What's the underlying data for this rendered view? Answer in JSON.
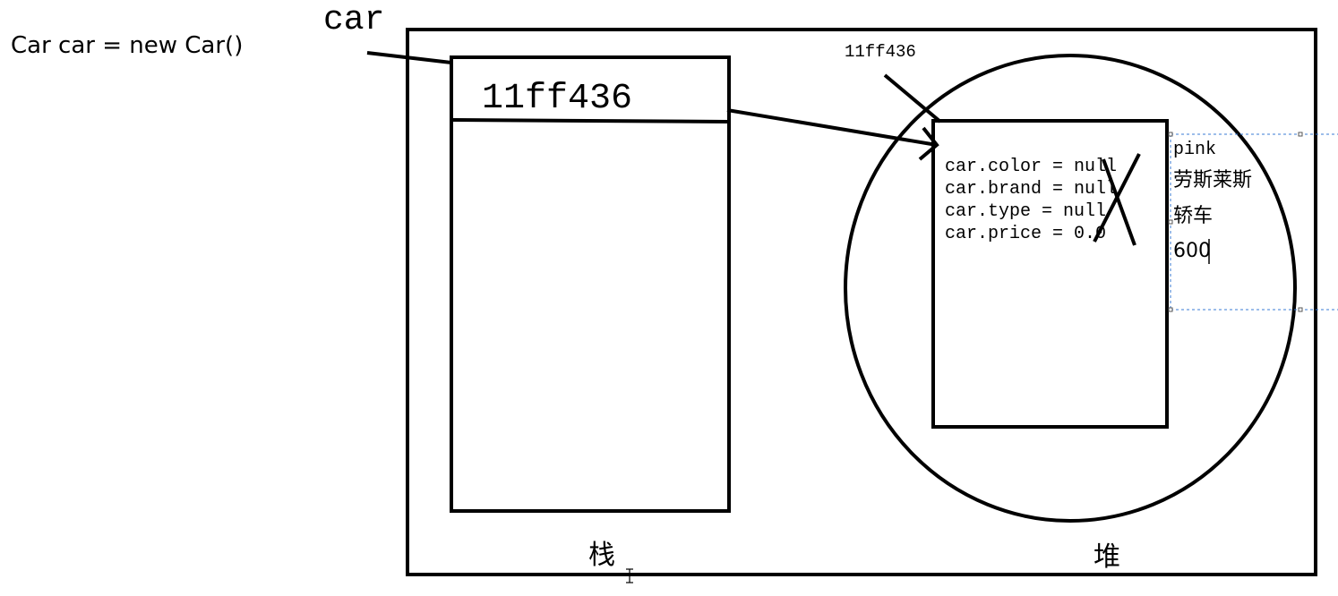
{
  "declaration": "Car car = new Car()",
  "variable_name": "car",
  "stack": {
    "address": "11ff436",
    "label": "栈"
  },
  "heap": {
    "address": "11ff436",
    "label": "堆",
    "defaults": [
      "car.color = null",
      "car.brand = null",
      "car.type = null",
      "car.price = 0.0"
    ],
    "assigned_values": [
      "pink",
      "劳斯莱斯",
      "轿车",
      "600"
    ]
  }
}
